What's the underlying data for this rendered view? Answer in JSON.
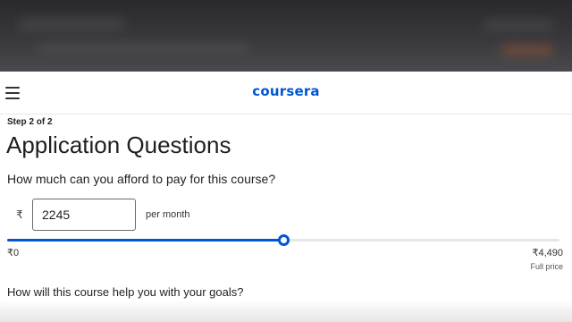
{
  "header": {
    "logo_text": "coursera",
    "menu_icon": "hamburger-menu-icon",
    "brand_color": "#0056d2"
  },
  "form": {
    "step": "Step 2 of 2",
    "title": "Application Questions",
    "question1": "How much can you afford to pay for this course?",
    "currency_symbol": "₹",
    "amount_value": "2245",
    "per_month": "per month",
    "slider": {
      "value": 2245,
      "min": 0,
      "max": 4490,
      "min_label": "₹0",
      "max_label": "₹4,490",
      "max_caption": "Full price"
    },
    "question2": "How will this course help you with your goals?"
  }
}
